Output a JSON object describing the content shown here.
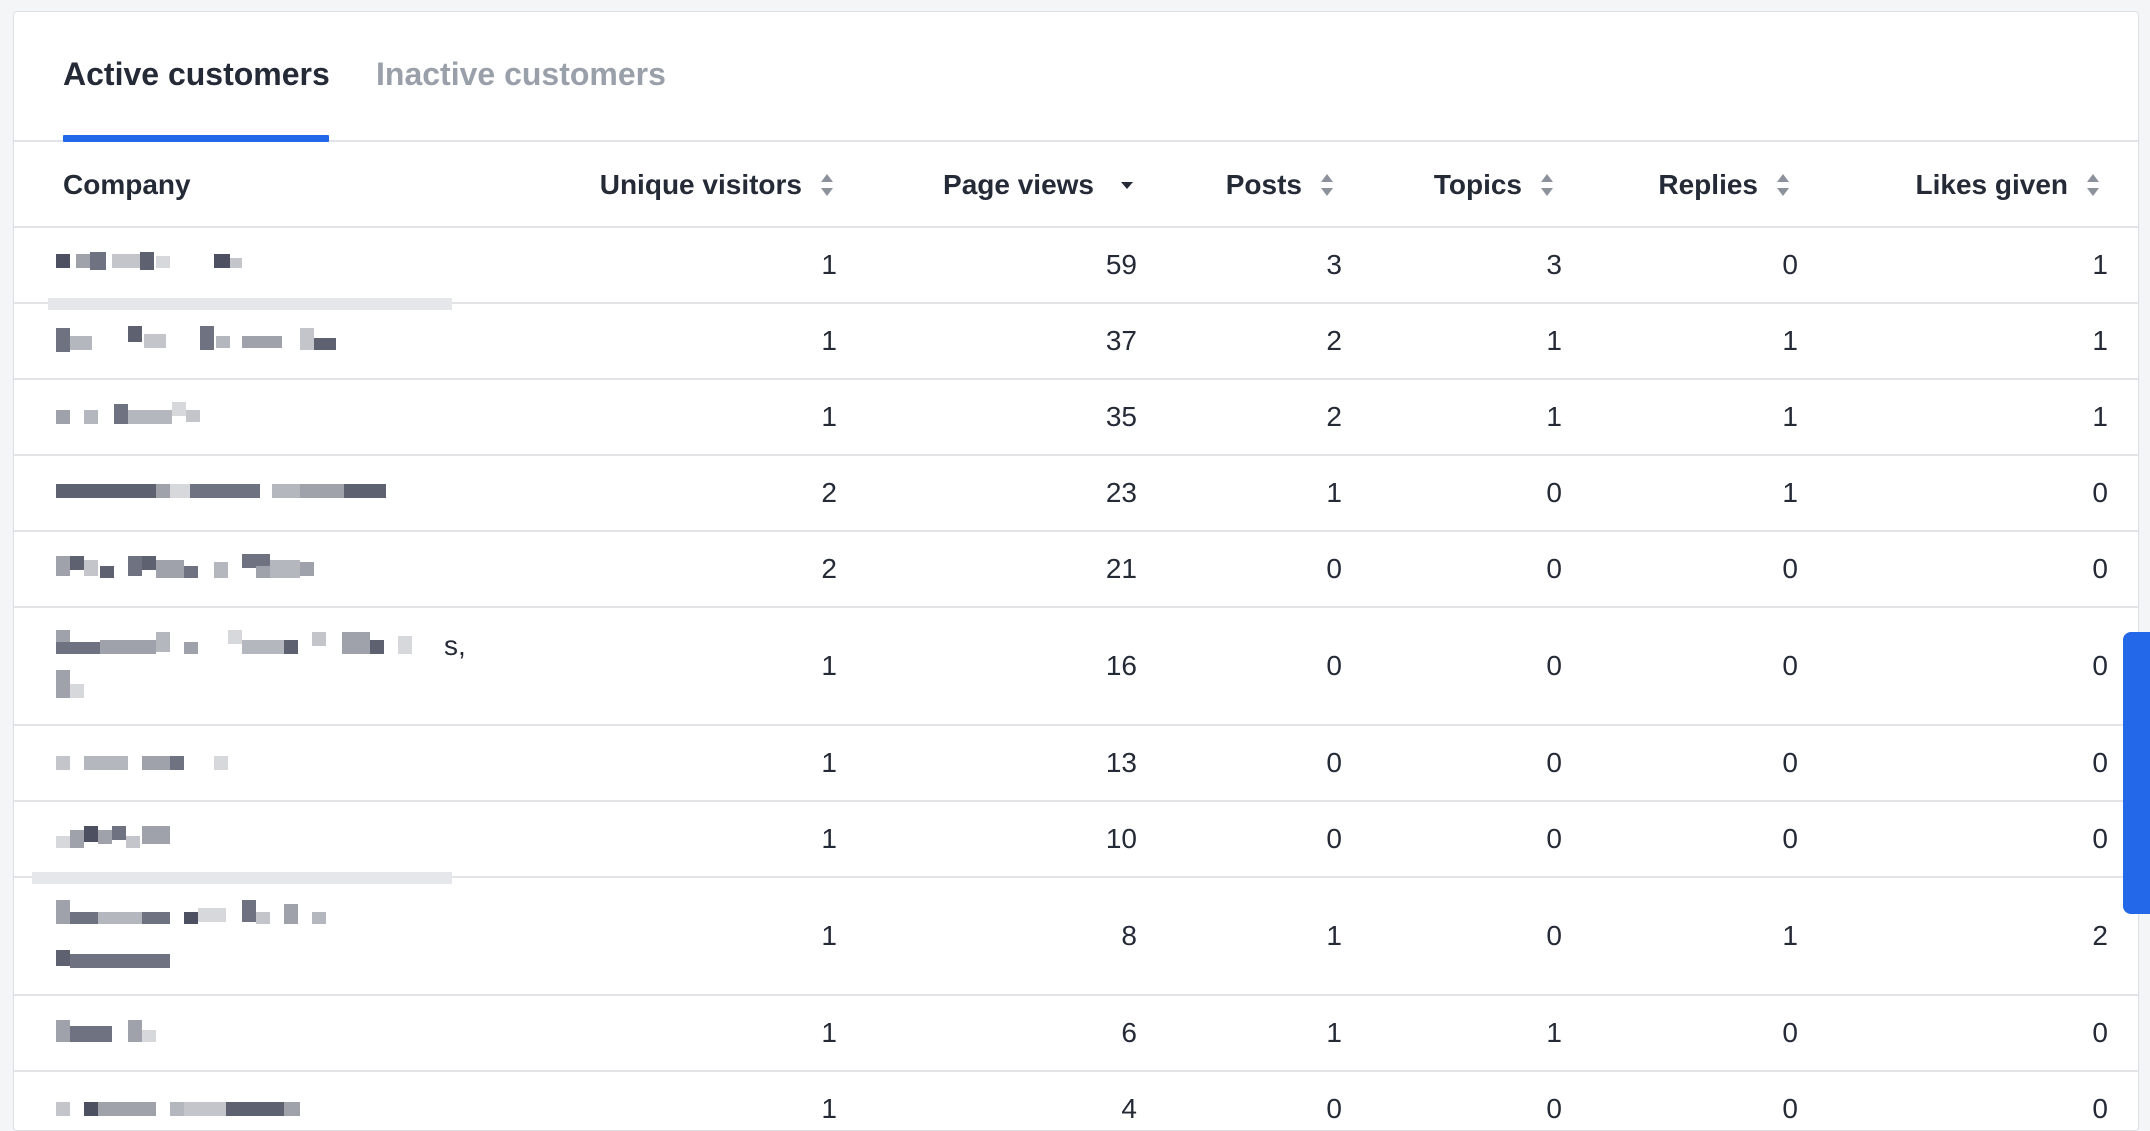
{
  "tabs": [
    {
      "label": "Active customers",
      "active": true
    },
    {
      "label": "Inactive customers",
      "active": false
    }
  ],
  "columns": {
    "company": "Company",
    "unique_visitors": "Unique visitors",
    "page_views": "Page views",
    "posts": "Posts",
    "topics": "Topics",
    "replies": "Replies",
    "likes_given": "Likes given"
  },
  "sort": {
    "column": "page_views",
    "direction": "descending"
  },
  "rows": [
    {
      "company": "",
      "unique_visitors": "1",
      "page_views": "59",
      "posts": "3",
      "topics": "3",
      "replies": "0",
      "likes_given": "1"
    },
    {
      "company": "",
      "unique_visitors": "1",
      "page_views": "37",
      "posts": "2",
      "topics": "1",
      "replies": "1",
      "likes_given": "1"
    },
    {
      "company": "",
      "unique_visitors": "1",
      "page_views": "35",
      "posts": "2",
      "topics": "1",
      "replies": "1",
      "likes_given": "1"
    },
    {
      "company": "",
      "unique_visitors": "2",
      "page_views": "23",
      "posts": "1",
      "topics": "0",
      "replies": "1",
      "likes_given": "0"
    },
    {
      "company": "",
      "unique_visitors": "2",
      "page_views": "21",
      "posts": "0",
      "topics": "0",
      "replies": "0",
      "likes_given": "0"
    },
    {
      "company": "s,",
      "unique_visitors": "1",
      "page_views": "16",
      "posts": "0",
      "topics": "0",
      "replies": "0",
      "likes_given": "0"
    },
    {
      "company": "",
      "unique_visitors": "1",
      "page_views": "13",
      "posts": "0",
      "topics": "0",
      "replies": "0",
      "likes_given": "0"
    },
    {
      "company": "",
      "unique_visitors": "1",
      "page_views": "10",
      "posts": "0",
      "topics": "0",
      "replies": "0",
      "likes_given": "0"
    },
    {
      "company": "",
      "unique_visitors": "1",
      "page_views": "8",
      "posts": "1",
      "topics": "0",
      "replies": "1",
      "likes_given": "2"
    },
    {
      "company": "",
      "unique_visitors": "1",
      "page_views": "6",
      "posts": "1",
      "topics": "1",
      "replies": "0",
      "likes_given": "0"
    },
    {
      "company": "",
      "unique_visitors": "1",
      "page_views": "4",
      "posts": "0",
      "topics": "0",
      "replies": "0",
      "likes_given": "0"
    }
  ],
  "colors": {
    "accent": "#2368e8",
    "text": "#252a37",
    "muted": "#9aa0aa",
    "border": "#e2e4e8"
  },
  "icons": {
    "sortable": "sort-up-down-icon",
    "sorted_desc": "caret-down-icon"
  }
}
